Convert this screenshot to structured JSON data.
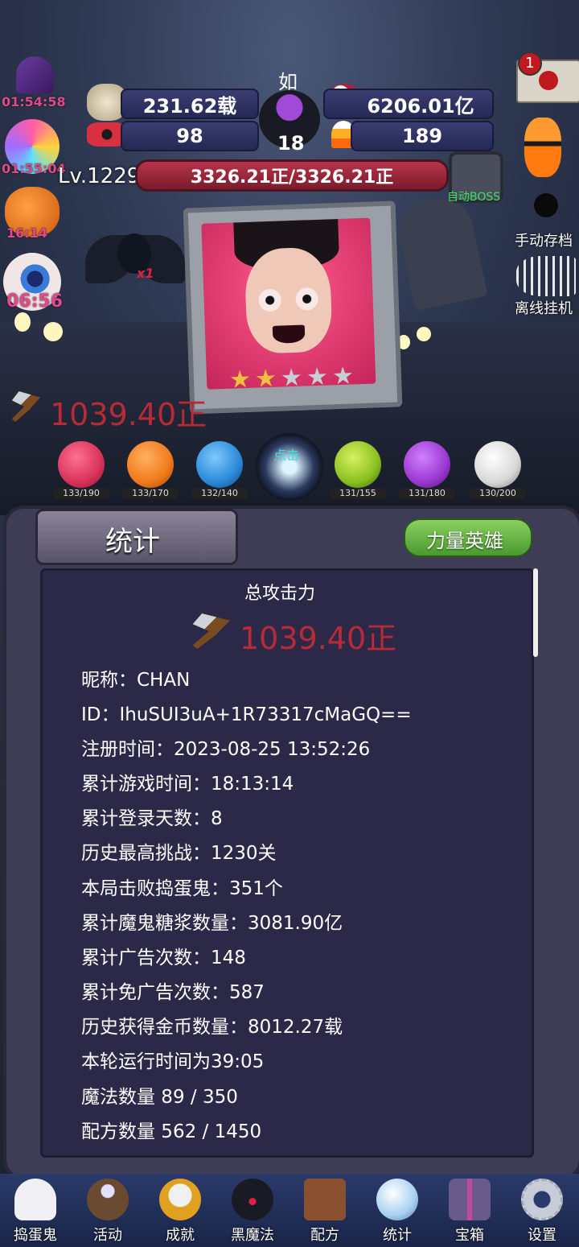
{
  "timers": [
    "01:54:58",
    "01:55:04",
    "16:14",
    "06:56"
  ],
  "player": {
    "name": "如",
    "level": "Lv.1229",
    "cauldron_count": "18"
  },
  "resources": {
    "coins": "231.62载",
    "skull_syrup": "6206.01亿",
    "candy_bow": "98",
    "candy_corn": "189"
  },
  "hp_bar": "3326.21正/3326.21正",
  "mail_badge": "1",
  "auto_boss": "自动BOSS",
  "side_buttons": {
    "manual_save": "手动存档",
    "offline": "离线挂机"
  },
  "attack_value": "1039.40正",
  "bat_multiplier": "x1",
  "orbs": [
    {
      "count": "133/190",
      "color": "#d8335a"
    },
    {
      "count": "133/170",
      "color": "#f07a1a"
    },
    {
      "count": "132/140",
      "color": "#2a8ad8"
    },
    {
      "count": "点击",
      "color": "#1a1a24"
    },
    {
      "count": "131/155",
      "color": "#8ac020"
    },
    {
      "count": "131/180",
      "color": "#9a38d0"
    },
    {
      "count": "130/200",
      "color": "#e8e8e8"
    }
  ],
  "panel": {
    "title": "统计",
    "hero_button": "力量英雄",
    "total_attack_label": "总攻击力",
    "total_attack_value": "1039.40正",
    "stats": [
      "昵称：CHAN",
      "ID：IhuSUI3uA+1R73317cMaGQ==",
      "注册时间：2023-08-25 13:52:26",
      "累计游戏时间：18:13:14",
      "累计登录天数：8",
      "历史最高挑战：1230关",
      "本局击败捣蛋鬼：351个",
      "累计魔鬼糖浆数量：3081.90亿",
      "累计广告次数：148",
      "累计免广告次数：587",
      "历史获得金币数量：8012.27载",
      "本轮运行时间为39:05",
      "魔法数量 89 / 350",
      "配方数量 562 / 1450"
    ]
  },
  "tabs": [
    "捣蛋鬼",
    "活动",
    "成就",
    "黑魔法",
    "配方",
    "统计",
    "宝箱",
    "设置"
  ]
}
